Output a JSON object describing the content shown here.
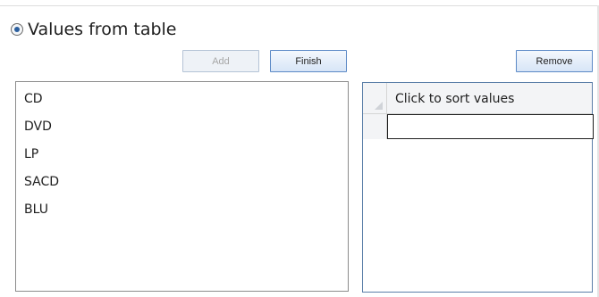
{
  "option": {
    "label": "Values from table",
    "selected": true
  },
  "buttons": {
    "add": "Add",
    "finish": "Finish",
    "remove": "Remove"
  },
  "values_list": {
    "items": [
      "CD",
      "DVD",
      "LP",
      "SACD",
      "BLU"
    ]
  },
  "sort_grid": {
    "header": "Click to sort values",
    "rows": [
      ""
    ]
  },
  "colors": {
    "accent_border": "#5b89c6",
    "radio_dot": "#2c5f9e",
    "disabled_text": "#a7a7a7"
  }
}
